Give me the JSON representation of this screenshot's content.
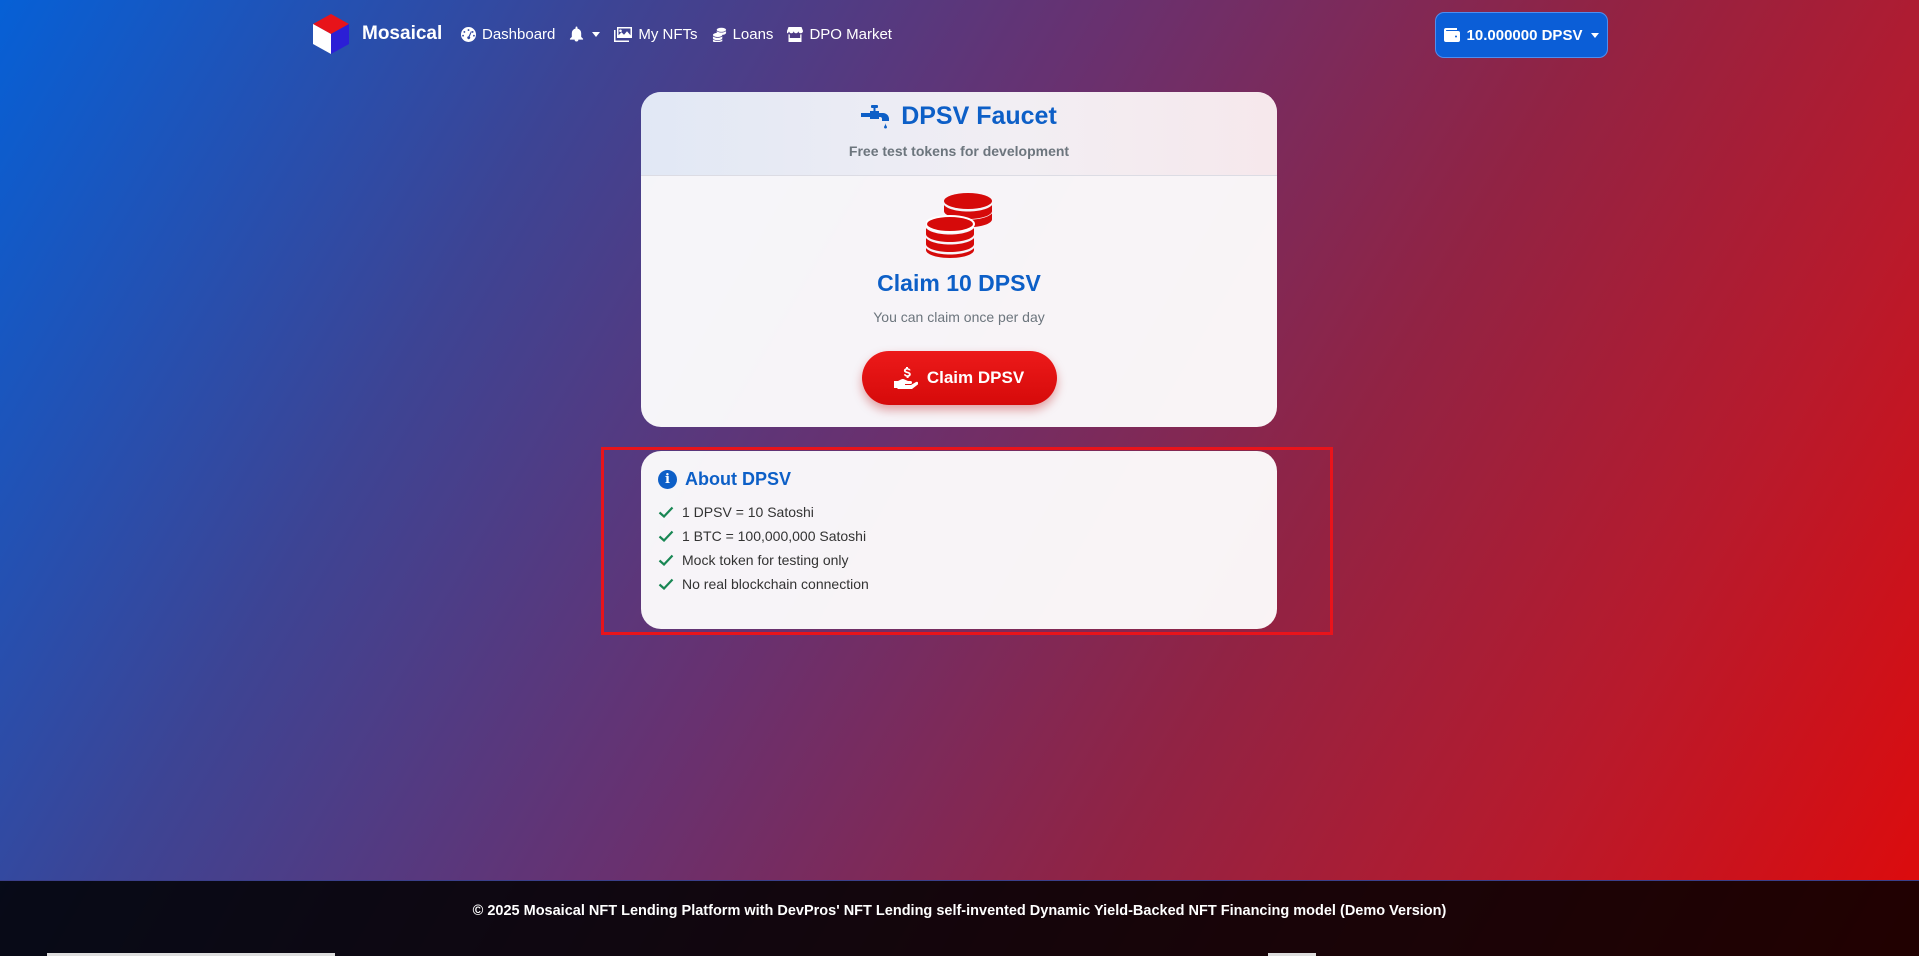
{
  "navbar": {
    "brand_name": "Mosaical",
    "links": [
      {
        "label": "Dashboard",
        "icon": "dashboard-icon"
      },
      {
        "label": "",
        "icon": "bell-icon"
      },
      {
        "label": "My NFTs",
        "icon": "images-icon"
      },
      {
        "label": "Loans",
        "icon": "coins-icon"
      },
      {
        "label": "DPO Market",
        "icon": "store-icon"
      }
    ],
    "wallet_balance": "10.000000 DPSV"
  },
  "faucet": {
    "title": "DPSV Faucet",
    "subtitle": "Free test tokens for development",
    "claim_heading": "Claim 10 DPSV",
    "claim_note": "You can claim once per day",
    "claim_button": "Claim DPSV"
  },
  "about": {
    "title": "About DPSV",
    "items": [
      "1 DPSV = 10 Satoshi",
      "1 BTC = 100,000,000 Satoshi",
      "Mock token for testing only",
      "No real blockchain connection"
    ]
  },
  "footer": {
    "text": "© 2025 Mosaical NFT Lending Platform with DevPros' NFT Lending self-invented Dynamic Yield-Backed NFT Financing model (Demo Version)"
  },
  "colors": {
    "primary": "#0d5fc7",
    "danger": "#e00a0a",
    "success": "#198754",
    "highlight": "#e8141b"
  }
}
